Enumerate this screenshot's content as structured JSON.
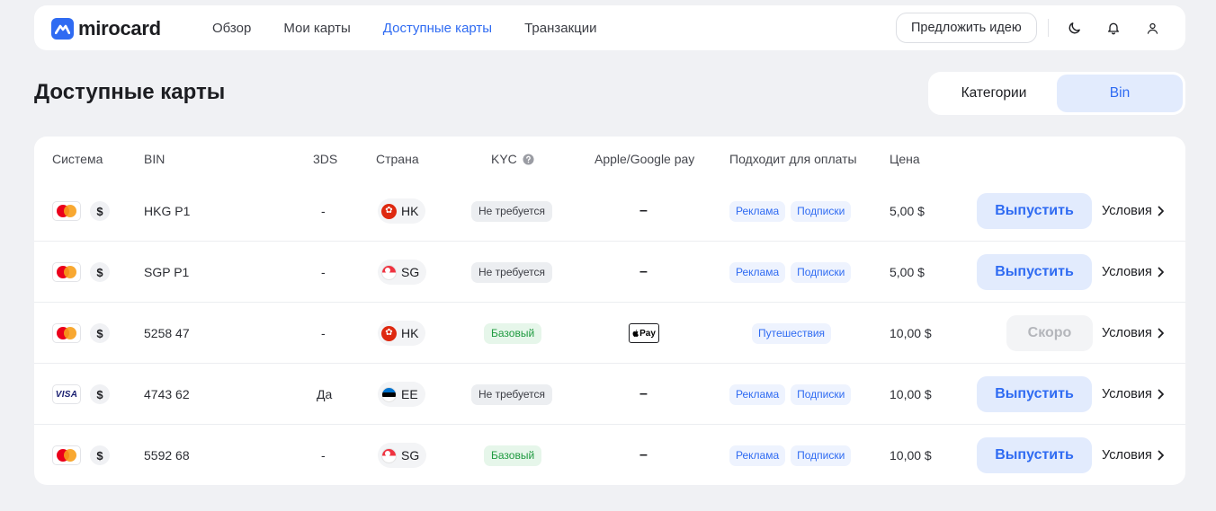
{
  "brand": {
    "name": "mirocard",
    "accent": "#2f6bf2"
  },
  "nav": {
    "items": [
      {
        "label": "Обзор"
      },
      {
        "label": "Мои карты"
      },
      {
        "label": "Доступные карты",
        "active": true
      },
      {
        "label": "Транзакции"
      }
    ],
    "suggest_idea": "Предложить идею",
    "icons": [
      "moon-icon",
      "bell-icon",
      "user-icon"
    ]
  },
  "page": {
    "title": "Доступные карты",
    "segments": [
      {
        "label": "Категории"
      },
      {
        "label": "Bin",
        "active": true
      }
    ]
  },
  "table": {
    "headers": {
      "system": "Система",
      "bin": "BIN",
      "tds": "3DS",
      "country": "Страна",
      "kyc": "KYC",
      "wallet": "Apple/Google pay",
      "usage": "Подходит для оплаты",
      "price": "Цена"
    },
    "rows": [
      {
        "network": "mastercard",
        "currency": "$",
        "bin": "HKG P1",
        "tds": "-",
        "country": "HK",
        "flag": "hk",
        "kyc": "Не требуется",
        "kyc_style": "gray",
        "wallet": "–",
        "tags": [
          "Реклама",
          "Подписки"
        ],
        "price": "5,00 $",
        "action": "Выпустить",
        "action_enabled": true,
        "terms": "Условия"
      },
      {
        "network": "mastercard",
        "currency": "$",
        "bin": "SGP P1",
        "tds": "-",
        "country": "SG",
        "flag": "sg",
        "kyc": "Не требуется",
        "kyc_style": "gray",
        "wallet": "–",
        "tags": [
          "Реклама",
          "Подписки"
        ],
        "price": "5,00 $",
        "action": "Выпустить",
        "action_enabled": true,
        "terms": "Условия"
      },
      {
        "network": "mastercard",
        "currency": "$",
        "bin": "5258 47",
        "tds": "-",
        "country": "HK",
        "flag": "hk",
        "kyc": "Базовый",
        "kyc_style": "green",
        "wallet": "Pay",
        "wallet_icon": "apple-pay-icon",
        "tags": [
          "Путешествия"
        ],
        "price": "10,00 $",
        "action": "Скоро",
        "action_enabled": false,
        "terms": "Условия"
      },
      {
        "network": "visa",
        "network_label": "VISA",
        "currency": "$",
        "bin": "4743 62",
        "tds": "Да",
        "country": "EE",
        "flag": "ee",
        "kyc": "Не требуется",
        "kyc_style": "gray",
        "wallet": "–",
        "tags": [
          "Реклама",
          "Подписки"
        ],
        "price": "10,00 $",
        "action": "Выпустить",
        "action_enabled": true,
        "terms": "Условия"
      },
      {
        "network": "mastercard",
        "currency": "$",
        "bin": "5592 68",
        "tds": "-",
        "country": "SG",
        "flag": "sg",
        "kyc": "Базовый",
        "kyc_style": "green",
        "wallet": "–",
        "tags": [
          "Реклама",
          "Подписки"
        ],
        "price": "10,00 $",
        "action": "Выпустить",
        "action_enabled": true,
        "terms": "Условия"
      }
    ]
  }
}
